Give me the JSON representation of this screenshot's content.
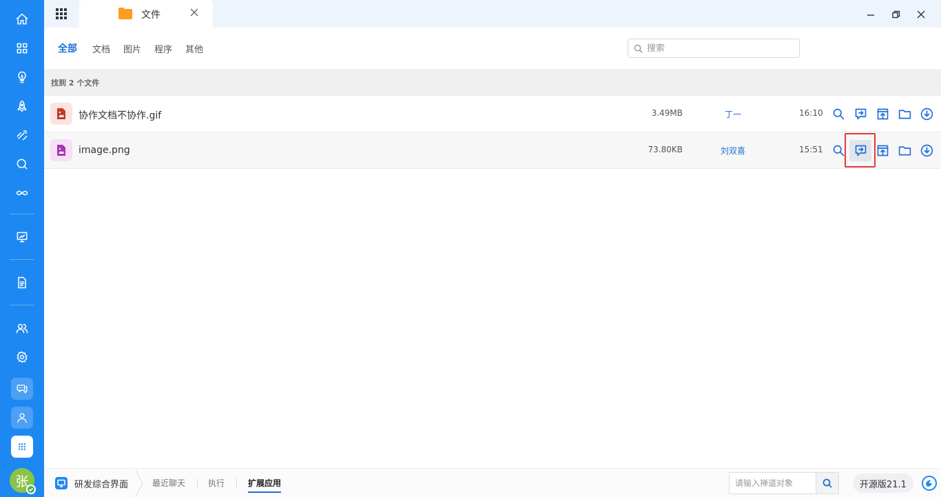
{
  "sidebar": {
    "items": [
      {
        "name": "home-icon"
      },
      {
        "name": "apps-grid-icon"
      },
      {
        "name": "lightbulb-icon"
      },
      {
        "name": "rocket-icon"
      },
      {
        "name": "sprint-icon"
      },
      {
        "name": "search-circle-icon"
      },
      {
        "name": "infinity-icon"
      },
      {
        "name": "presentation-icon"
      },
      {
        "name": "document-icon"
      },
      {
        "name": "users-icon"
      },
      {
        "name": "settings-icon"
      }
    ],
    "avatar_text": "张"
  },
  "topbar": {
    "tab_label": "文件"
  },
  "filters": {
    "items": [
      "全部",
      "文档",
      "图片",
      "程序",
      "其他"
    ],
    "search_placeholder": "搜索"
  },
  "results": {
    "summary": "找到 2 个文件",
    "files": [
      {
        "name": "协作文档不协作.gif",
        "size": "3.49MB",
        "owner": "丁一",
        "time": "16:10",
        "icon_color": "#c0392b",
        "icon_bg": "#fbe3e1"
      },
      {
        "name": "image.png",
        "size": "73.80KB",
        "owner": "刘双喜",
        "time": "15:51",
        "icon_color": "#a537b4",
        "icon_bg": "#f6dff8"
      }
    ]
  },
  "bottombar": {
    "project": "研发综合界面",
    "links": [
      "最近聊天",
      "执行",
      "扩展应用"
    ],
    "search_placeholder": "请输入禅道对象",
    "version": "开源版21.1"
  },
  "colors": {
    "sidebar": "#1e88f2",
    "accent": "#1e6fd9"
  }
}
